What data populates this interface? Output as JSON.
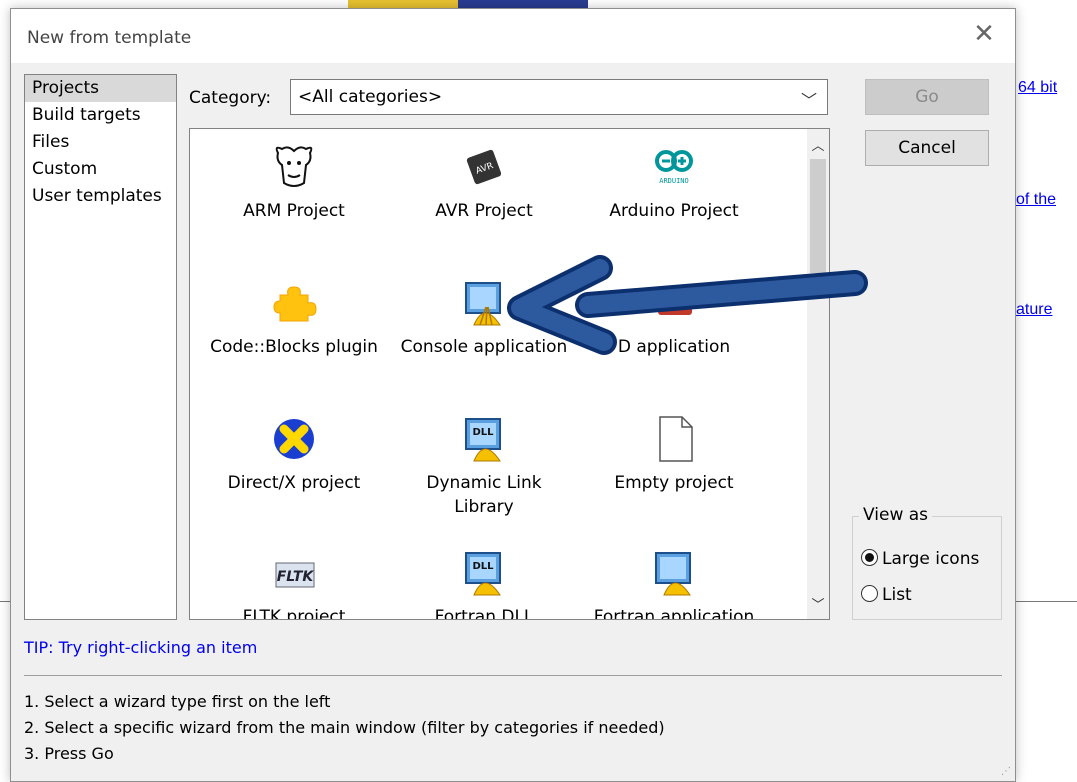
{
  "background": {
    "links": [
      "64 bit",
      "of the",
      "ature"
    ]
  },
  "dialog": {
    "title": "New from template",
    "close_glyph": "✕",
    "left_list": [
      "Projects",
      "Build targets",
      "Files",
      "Custom",
      "User templates"
    ],
    "category_label": "Category:",
    "category_value": "<All categories>",
    "go_label": "Go",
    "cancel_label": "Cancel",
    "view_as": {
      "legend": "View as",
      "large_icons": "Large icons",
      "list": "List",
      "selected": "Large icons"
    },
    "tip": "TIP: Try right-clicking an item",
    "instructions": [
      "1. Select a wizard type first on the left",
      "2. Select a specific wizard from the main window (filter by categories if needed)",
      "3. Press Go"
    ],
    "templates": [
      {
        "label": "ARM Project",
        "icon": "gnu-icon"
      },
      {
        "label": "AVR Project",
        "icon": "avr-chip-icon",
        "icon_text": "AVR"
      },
      {
        "label": "Arduino Project",
        "icon": "arduino-icon",
        "icon_text": "ARDUINO"
      },
      {
        "label": "Code::Blocks plugin",
        "icon": "puzzle-icon"
      },
      {
        "label": "Console application",
        "icon": "console-app-icon"
      },
      {
        "label": "D application",
        "icon": "d-app-icon"
      },
      {
        "label": "Direct/X project",
        "icon": "directx-icon"
      },
      {
        "label": "Dynamic Link",
        "label2": "Library",
        "icon": "dll-icon",
        "icon_text": "DLL"
      },
      {
        "label": "Empty project",
        "icon": "blank-page-icon"
      },
      {
        "label": "FLTK project",
        "icon": "fltk-icon",
        "icon_text": "FLTK"
      },
      {
        "label": "Fortran DLL",
        "icon": "fortran-dll-icon",
        "icon_text": "DLL"
      },
      {
        "label": "Fortran application",
        "icon": "fortran-app-icon"
      }
    ]
  }
}
